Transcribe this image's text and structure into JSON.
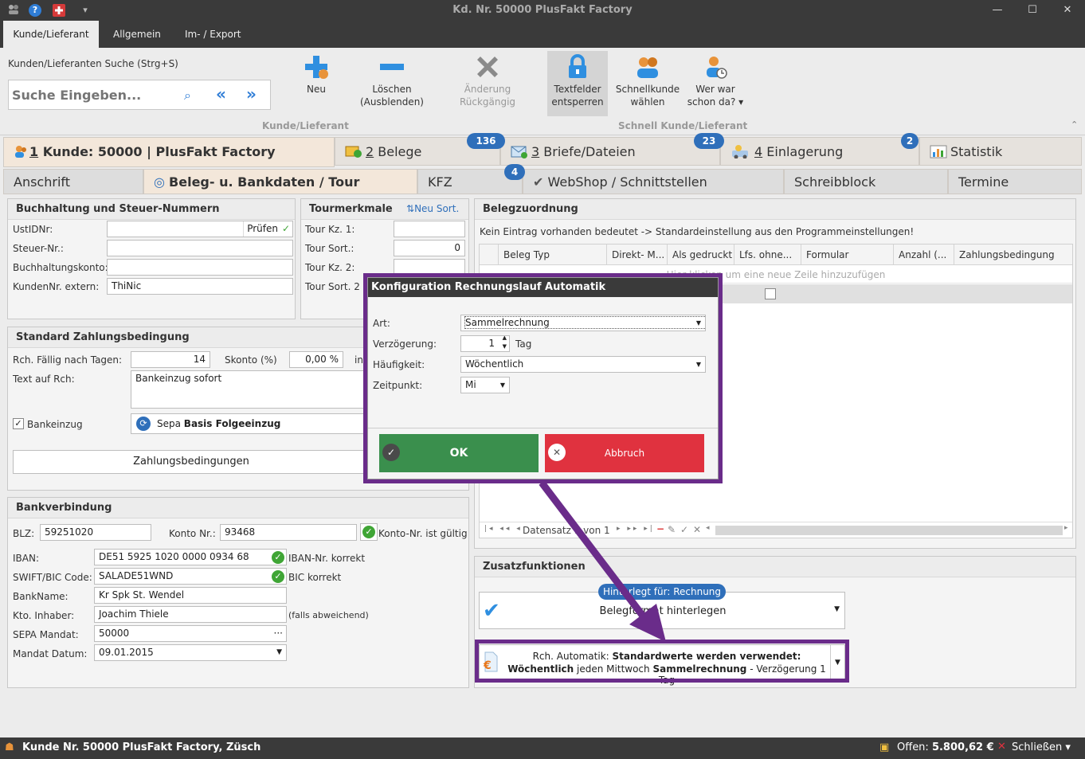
{
  "window": {
    "title": "Kd. Nr. 50000 PlusFakt Factory",
    "min": "—",
    "max": "☐",
    "close": "✕"
  },
  "quick_access": {
    "help": "?",
    "menu": "▾"
  },
  "ribbon_tabs": [
    "Kunde/Lieferant",
    "Allgemein",
    "Im- / Export"
  ],
  "ribbon": {
    "search_label": "Kunden/Lieferanten Suche (Strg+S)",
    "search_placeholder": "Suche Eingeben...",
    "buttons": {
      "neu": "Neu",
      "loeschen_1": "Löschen",
      "loeschen_2": "(Ausblenden)",
      "aenderung": "Änderung Rückgängig",
      "textfelder_1": "Textfelder",
      "textfelder_2": "entsperren",
      "schnellkunde_1": "Schnellkunde",
      "schnellkunde_2": "wählen",
      "werwar_1": "Wer war",
      "werwar_2": "schon da? ▾"
    },
    "group1": "Kunde/Lieferant",
    "group2": "Schnell Kunde/Lieferant"
  },
  "main_tabs": {
    "t1_num": "1",
    "t1_label": " Kunde: 50000 | PlusFakt Factory",
    "t2_num": "2",
    "t2_label": " Belege",
    "t2_badge": "136",
    "t3_num": "3",
    "t3_label": " Briefe/Dateien",
    "t3_badge": "23",
    "t4_num": "4",
    "t4_label": " Einlagerung",
    "t4_badge": "2",
    "t5_label": "Statistik"
  },
  "sub_tabs": {
    "anschrift": "Anschrift",
    "beleg": "Beleg- u. Bankdaten / Tour",
    "kfz": "KFZ",
    "kfz_badge": "4",
    "webshop": "WebShop / Schnittstellen",
    "schreibblock": "Schreibblock",
    "termine": "Termine"
  },
  "buchhaltung": {
    "title": "Buchhaltung und Steuer-Nummern",
    "ustid_label": "UstIDNr:",
    "ustid_value": "",
    "pruefen": "Prüfen",
    "steuer_label": "Steuer-Nr.:",
    "steuer_value": "",
    "konto_label": "Buchhaltungskonto:",
    "konto_value": "",
    "extern_label": "KundenNr. extern:",
    "extern_value": "ThiNic"
  },
  "tour": {
    "title": "Tourmerkmale",
    "neu_sort": "Neu Sort.",
    "kz1_label": "Tour Kz. 1:",
    "kz1_value": "",
    "sort1_label": "Tour Sort.:",
    "sort1_value": "0",
    "kz2_label": "Tour Kz. 2:",
    "kz2_value": "",
    "sort2_label": "Tour Sort. 2",
    "sort2_value": ""
  },
  "zahlung": {
    "title": "Standard Zahlungsbedingung",
    "faellig_label": "Rch. Fällig nach Tagen:",
    "faellig_value": "14",
    "skonto_label": "Skonto (%)",
    "skonto_value": "0,00 %",
    "in_label": "in",
    "text_label": "Text auf Rch:",
    "text_value": "Bankeinzug sofort",
    "bankeinzug_label": "Bankeinzug",
    "sepa_value_pre": "Sepa ",
    "sepa_value_bold": "Basis Folgeeinzug",
    "button": "Zahlungsbedingungen"
  },
  "bank": {
    "title": "Bankverbindung",
    "blz_label": "BLZ:",
    "blz_value": "59251020",
    "konto_label": "Konto Nr.:",
    "konto_value": "93468",
    "konto_ok": "Konto-Nr. ist gültig",
    "iban_label": "IBAN:",
    "iban_value": "DE51 5925 1020 0000 0934 68",
    "iban_ok": "IBAN-Nr. korrekt",
    "bic_label": "SWIFT/BIC Code:",
    "bic_value": "SALADE51WND",
    "bic_ok": "BIC korrekt",
    "name_label": "BankName:",
    "name_value": "Kr Spk St. Wendel",
    "inhaber_label": "Kto. Inhaber:",
    "inhaber_value": "Joachim Thiele",
    "inhaber_hint": "(falls abweichend)",
    "mandat_label": "SEPA Mandat:",
    "mandat_value": "50000",
    "datum_label": "Mandat Datum:",
    "datum_value": "09.01.2015"
  },
  "belegzuordnung": {
    "title": "Belegzuordnung",
    "info": "Kein Eintrag vorhanden bedeutet -> Standardeinstellung aus den Programmeinstellungen!",
    "columns": [
      "Beleg Typ",
      "Direkt- M...",
      "Als gedruckt",
      "Lfs. ohne...",
      "Formular",
      "Anzahl (...",
      "Zahlungsbedingung"
    ],
    "new_row_hint": "Hier klicken um eine neue Zeile hinzuzufügen",
    "navigator": "Datensatz 1 von 1"
  },
  "zusatz": {
    "title": "Zusatzfunktionen",
    "hinterlegt_badge": "Hinterlegt für: Rechnung",
    "beleg_format": "Belegformat hinterlegen",
    "auto_1_pre": "Rch. Automatik: ",
    "auto_1_bold": "Standardwerte werden verwendet:",
    "auto_2_b1": "Wöchentlich",
    "auto_2_t1": " jeden Mittwoch ",
    "auto_2_b2": "Sammelrechnung",
    "auto_2_t2": " - Verzögerung 1 Tag"
  },
  "dialog": {
    "title": "Konfiguration Rechnungslauf Automatik",
    "art_label": "Art:",
    "art_value": "Sammelrechnung",
    "verz_label": "Verzögerung:",
    "verz_value": "1",
    "verz_unit": "Tag",
    "haeuf_label": "Häufigkeit:",
    "haeuf_value": "Wöchentlich",
    "zeit_label": "Zeitpunkt:",
    "zeit_value": "Mi",
    "ok": "OK",
    "abbruch": "Abbruch"
  },
  "statusbar": {
    "left": "Kunde Nr. 50000 PlusFakt Factory, Züsch",
    "offen_label": "Offen: ",
    "offen_value": "5.800,62 €",
    "schliessen": "Schließen ▾"
  },
  "colors": {
    "accent": "#2f6fba",
    "ok_green": "#3a8f4d",
    "cancel_red": "#e0323f",
    "highlight": "#6a2c8a"
  }
}
